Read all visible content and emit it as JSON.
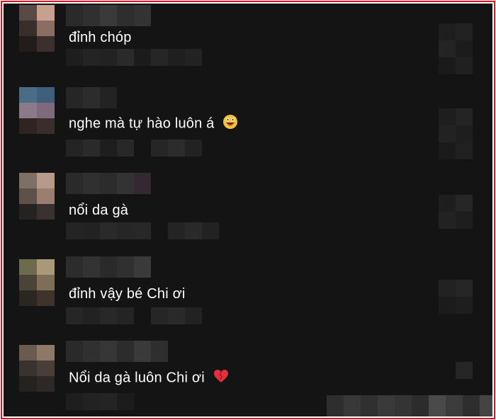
{
  "colors": {
    "frame_border": "#e0141e",
    "background": "#141414",
    "text": "#ffffff",
    "heart": "#e3303c",
    "emoji_face": "#f7c23b"
  },
  "comments": [
    {
      "text": "đỉnh chóp",
      "emoji": ""
    },
    {
      "text": "nghe mà tự hào luôn á",
      "emoji": "grinning-face-icon"
    },
    {
      "text": "nổi da gà",
      "emoji": ""
    },
    {
      "text": "đỉnh vậy bé Chi ơi",
      "emoji": ""
    },
    {
      "text": "Nổi da gà luôn Chi ơi",
      "emoji": "heart-icon"
    }
  ]
}
